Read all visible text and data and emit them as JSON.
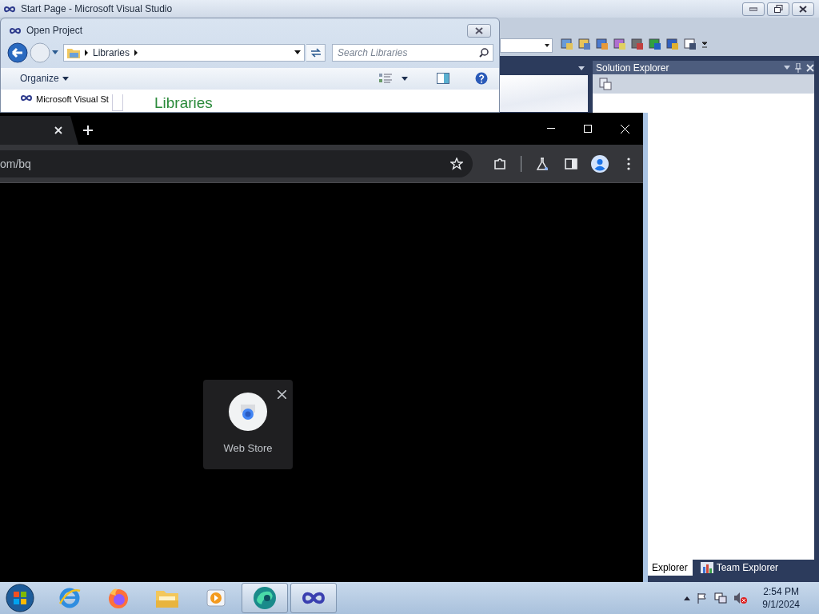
{
  "vs_window": {
    "title": "Start Page - Microsoft Visual Studio"
  },
  "solution_explorer": {
    "title": "Solution Explorer",
    "tabs": [
      {
        "label": "Explorer",
        "selected": true
      },
      {
        "label": "Team Explorer",
        "selected": false
      }
    ]
  },
  "open_project_dialog": {
    "title": "Open Project",
    "breadcrumb": "Libraries",
    "search": {
      "placeholder": "Search Libraries"
    },
    "organize": "Organize",
    "nav_item": "Microsoft Visual St",
    "heading": "Libraries"
  },
  "browser": {
    "address": "om/bq",
    "shortcut": {
      "label": "Web Store"
    }
  },
  "taskbar": {
    "apps": [
      {
        "kind": "ie",
        "selected": false
      },
      {
        "kind": "firefox",
        "selected": false
      },
      {
        "kind": "folder",
        "selected": false
      },
      {
        "kind": "media",
        "selected": false
      },
      {
        "kind": "edge",
        "selected": true
      },
      {
        "kind": "vs",
        "selected": true
      }
    ],
    "clock": {
      "time": "2:54 PM",
      "date": "9/1/2024"
    }
  }
}
